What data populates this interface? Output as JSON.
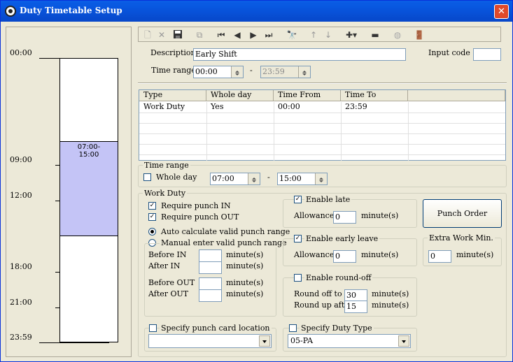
{
  "window": {
    "title": "Duty Timetable Setup",
    "close_glyph": "✕",
    "icon": "app-gear-icon"
  },
  "timeline": {
    "labels": [
      "00:00",
      "09:00",
      "12:00",
      "18:00",
      "21:00",
      "23:59"
    ],
    "segment_label_line1": "07:00-",
    "segment_label_line2": "15:00",
    "segment_color": "#c4c4f6"
  },
  "toolbar": {
    "icons": [
      "new-icon",
      "delete-icon",
      "save-icon",
      "copy-icon",
      "first-record-icon",
      "previous-record-icon",
      "next-record-icon",
      "last-record-icon",
      "find-icon",
      "move-up-icon",
      "move-down-icon",
      "add-icon",
      "remove-icon",
      "disabled-icon",
      "exit-icon"
    ]
  },
  "form": {
    "description_label": "Description",
    "description_value": "Early Shift",
    "input_code_label": "Input code :",
    "input_code_value": "",
    "time_range_label": "Time range",
    "time_from": "00:00",
    "time_dash": "-",
    "time_to": "23:59"
  },
  "table": {
    "columns": [
      "Type",
      "Whole day",
      "Time From",
      "Time To"
    ],
    "rows": [
      {
        "type": "Work Duty",
        "whole_day": "Yes",
        "from": "00:00",
        "to": "23:59"
      }
    ]
  },
  "time_range_group": {
    "title": "Time range",
    "whole_day_label": "Whole day",
    "whole_day_checked": false,
    "from": "07:00",
    "dash": "-",
    "to": "15:00"
  },
  "work_duty": {
    "title": "Work Duty",
    "require_in_label": "Require punch IN",
    "require_in": true,
    "require_out_label": "Require punch OUT",
    "require_out": true,
    "auto_calc_label": "Auto calculate valid punch range",
    "manual_label": "Manual enter valid punch range",
    "before_in_label": "Before IN",
    "after_in_label": "After IN",
    "before_out_label": "Before OUT",
    "after_out_label": "After OUT",
    "minute_label": "minute(s)",
    "before_in": "",
    "after_in": "",
    "before_out": "",
    "after_out": ""
  },
  "late": {
    "label": "Enable late",
    "checked": true,
    "allowance_label": "Allowance",
    "allowance": "0",
    "minute_label": "minute(s)"
  },
  "early_leave": {
    "label": "Enable early leave",
    "checked": true,
    "allowance_label": "Allowance",
    "allowance": "0",
    "minute_label": "minute(s)"
  },
  "roundoff": {
    "label": "Enable round-off",
    "checked": false,
    "round_off_label": "Round off to",
    "round_off": "30",
    "round_up_label": "Round up after",
    "round_up": "15",
    "minute_label": "minute(s)"
  },
  "punch_order_label": "Punch Order",
  "extra_work": {
    "title": "Extra Work Min.",
    "value": "0",
    "minute_label": "minute(s)"
  },
  "punch_location": {
    "label": "Specify punch card location",
    "checked": false,
    "value": ""
  },
  "duty_type": {
    "label": "Specify Duty Type",
    "checked": false,
    "value": "05-PA"
  },
  "check_glyph": "✓"
}
